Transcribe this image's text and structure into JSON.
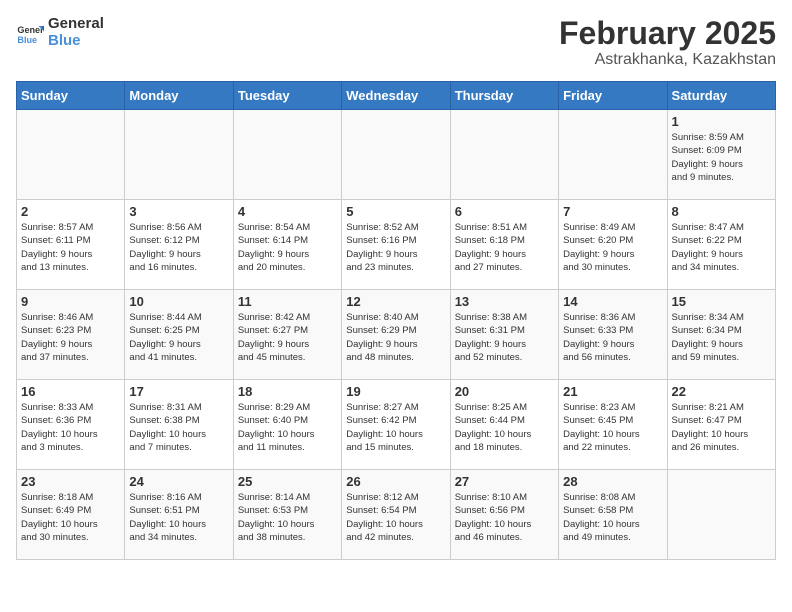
{
  "logo": {
    "line1": "General",
    "line2": "Blue"
  },
  "title": {
    "month_year": "February 2025",
    "location": "Astrakhanka, Kazakhstan"
  },
  "days_of_week": [
    "Sunday",
    "Monday",
    "Tuesday",
    "Wednesday",
    "Thursday",
    "Friday",
    "Saturday"
  ],
  "weeks": [
    [
      {
        "day": null,
        "info": null
      },
      {
        "day": null,
        "info": null
      },
      {
        "day": null,
        "info": null
      },
      {
        "day": null,
        "info": null
      },
      {
        "day": null,
        "info": null
      },
      {
        "day": null,
        "info": null
      },
      {
        "day": "1",
        "info": "Sunrise: 8:59 AM\nSunset: 6:09 PM\nDaylight: 9 hours\nand 9 minutes."
      }
    ],
    [
      {
        "day": "2",
        "info": "Sunrise: 8:57 AM\nSunset: 6:11 PM\nDaylight: 9 hours\nand 13 minutes."
      },
      {
        "day": "3",
        "info": "Sunrise: 8:56 AM\nSunset: 6:12 PM\nDaylight: 9 hours\nand 16 minutes."
      },
      {
        "day": "4",
        "info": "Sunrise: 8:54 AM\nSunset: 6:14 PM\nDaylight: 9 hours\nand 20 minutes."
      },
      {
        "day": "5",
        "info": "Sunrise: 8:52 AM\nSunset: 6:16 PM\nDaylight: 9 hours\nand 23 minutes."
      },
      {
        "day": "6",
        "info": "Sunrise: 8:51 AM\nSunset: 6:18 PM\nDaylight: 9 hours\nand 27 minutes."
      },
      {
        "day": "7",
        "info": "Sunrise: 8:49 AM\nSunset: 6:20 PM\nDaylight: 9 hours\nand 30 minutes."
      },
      {
        "day": "8",
        "info": "Sunrise: 8:47 AM\nSunset: 6:22 PM\nDaylight: 9 hours\nand 34 minutes."
      }
    ],
    [
      {
        "day": "9",
        "info": "Sunrise: 8:46 AM\nSunset: 6:23 PM\nDaylight: 9 hours\nand 37 minutes."
      },
      {
        "day": "10",
        "info": "Sunrise: 8:44 AM\nSunset: 6:25 PM\nDaylight: 9 hours\nand 41 minutes."
      },
      {
        "day": "11",
        "info": "Sunrise: 8:42 AM\nSunset: 6:27 PM\nDaylight: 9 hours\nand 45 minutes."
      },
      {
        "day": "12",
        "info": "Sunrise: 8:40 AM\nSunset: 6:29 PM\nDaylight: 9 hours\nand 48 minutes."
      },
      {
        "day": "13",
        "info": "Sunrise: 8:38 AM\nSunset: 6:31 PM\nDaylight: 9 hours\nand 52 minutes."
      },
      {
        "day": "14",
        "info": "Sunrise: 8:36 AM\nSunset: 6:33 PM\nDaylight: 9 hours\nand 56 minutes."
      },
      {
        "day": "15",
        "info": "Sunrise: 8:34 AM\nSunset: 6:34 PM\nDaylight: 9 hours\nand 59 minutes."
      }
    ],
    [
      {
        "day": "16",
        "info": "Sunrise: 8:33 AM\nSunset: 6:36 PM\nDaylight: 10 hours\nand 3 minutes."
      },
      {
        "day": "17",
        "info": "Sunrise: 8:31 AM\nSunset: 6:38 PM\nDaylight: 10 hours\nand 7 minutes."
      },
      {
        "day": "18",
        "info": "Sunrise: 8:29 AM\nSunset: 6:40 PM\nDaylight: 10 hours\nand 11 minutes."
      },
      {
        "day": "19",
        "info": "Sunrise: 8:27 AM\nSunset: 6:42 PM\nDaylight: 10 hours\nand 15 minutes."
      },
      {
        "day": "20",
        "info": "Sunrise: 8:25 AM\nSunset: 6:44 PM\nDaylight: 10 hours\nand 18 minutes."
      },
      {
        "day": "21",
        "info": "Sunrise: 8:23 AM\nSunset: 6:45 PM\nDaylight: 10 hours\nand 22 minutes."
      },
      {
        "day": "22",
        "info": "Sunrise: 8:21 AM\nSunset: 6:47 PM\nDaylight: 10 hours\nand 26 minutes."
      }
    ],
    [
      {
        "day": "23",
        "info": "Sunrise: 8:18 AM\nSunset: 6:49 PM\nDaylight: 10 hours\nand 30 minutes."
      },
      {
        "day": "24",
        "info": "Sunrise: 8:16 AM\nSunset: 6:51 PM\nDaylight: 10 hours\nand 34 minutes."
      },
      {
        "day": "25",
        "info": "Sunrise: 8:14 AM\nSunset: 6:53 PM\nDaylight: 10 hours\nand 38 minutes."
      },
      {
        "day": "26",
        "info": "Sunrise: 8:12 AM\nSunset: 6:54 PM\nDaylight: 10 hours\nand 42 minutes."
      },
      {
        "day": "27",
        "info": "Sunrise: 8:10 AM\nSunset: 6:56 PM\nDaylight: 10 hours\nand 46 minutes."
      },
      {
        "day": "28",
        "info": "Sunrise: 8:08 AM\nSunset: 6:58 PM\nDaylight: 10 hours\nand 49 minutes."
      },
      {
        "day": null,
        "info": null
      }
    ]
  ]
}
